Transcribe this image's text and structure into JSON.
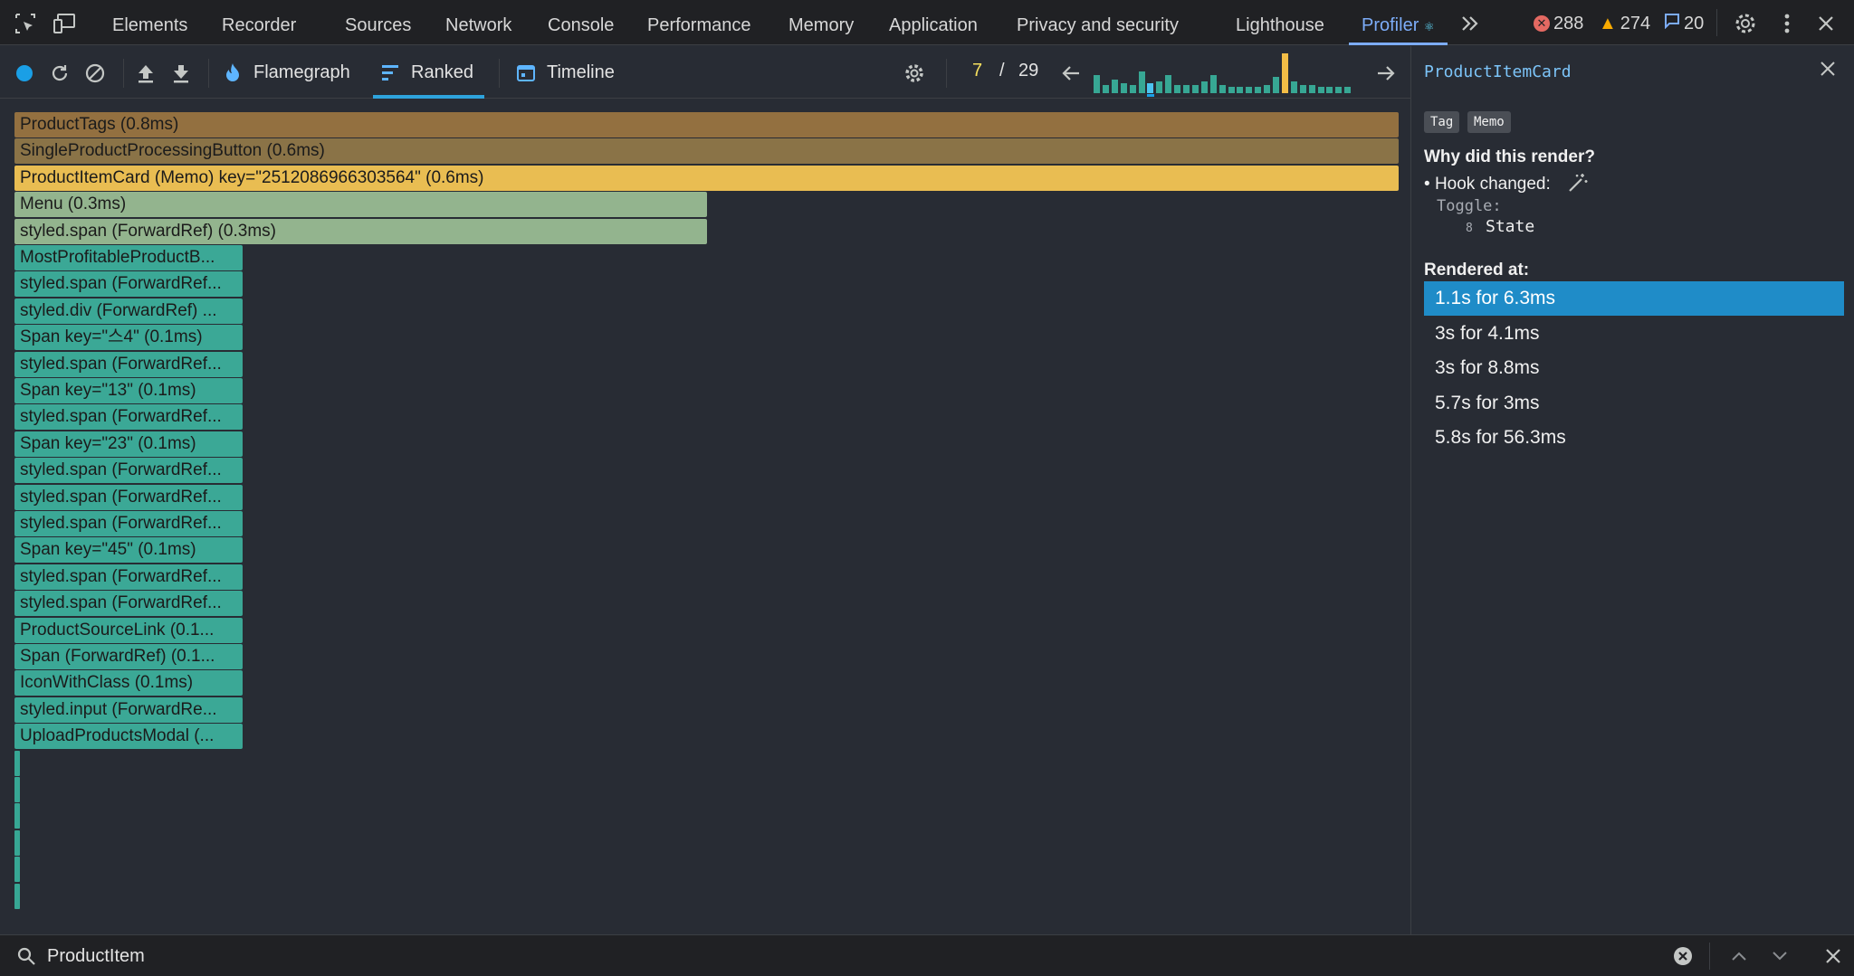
{
  "topbar": {
    "tabs": [
      {
        "label": "Elements"
      },
      {
        "label": "Recorder"
      },
      {
        "label": "Sources"
      },
      {
        "label": "Network"
      },
      {
        "label": "Console"
      },
      {
        "label": "Performance"
      },
      {
        "label": "Memory"
      },
      {
        "label": "Application"
      },
      {
        "label": "Privacy and security"
      },
      {
        "label": "Lighthouse"
      },
      {
        "label": "Profiler"
      }
    ],
    "active_tab": "Profiler",
    "errors": "288",
    "warnings": "274",
    "messages": "20",
    "icons": [
      "inspect-element-icon",
      "device-toggle-icon",
      "more-tabs-icon",
      "settings-gear-icon",
      "kebab-menu-icon",
      "close-icon"
    ]
  },
  "toolbar": {
    "modes": [
      {
        "label": "Flamegraph",
        "icon": "flame-icon"
      },
      {
        "label": "Ranked",
        "icon": "ranked-bars-icon"
      },
      {
        "label": "Timeline",
        "icon": "calendar-icon"
      }
    ],
    "active_mode": "Ranked",
    "commit_current": "7",
    "commit_sep": "/",
    "commit_total": "29",
    "commit_bars": [
      0.45,
      0.2,
      0.35,
      0.25,
      0.2,
      0.55,
      0.25,
      0.3,
      0.45,
      0.2,
      0.2,
      0.2,
      0.3,
      0.45,
      0.2,
      0.15,
      0.15,
      0.15,
      0.15,
      0.2,
      0.4,
      1.0,
      0.3,
      0.2,
      0.2,
      0.15,
      0.15,
      0.15,
      0.15
    ],
    "commit_selected_index": 6,
    "commit_highlight_index": 21
  },
  "ranked": {
    "rows": [
      {
        "label": "ProductTags (0.8ms)",
        "width": 1.0,
        "color": "#937040"
      },
      {
        "label": "SingleProductProcessingButton (0.6ms)",
        "width": 1.0,
        "color": "#8a7347"
      },
      {
        "label": "ProductItemCard (Memo) key=\"2512086966303564\" (0.6ms)",
        "width": 1.0,
        "color": "#e9bd52"
      },
      {
        "label": "Menu (0.3ms)",
        "width": 0.5,
        "color": "#93b48e"
      },
      {
        "label": "styled.span (ForwardRef) (0.3ms)",
        "width": 0.5,
        "color": "#93b48e"
      },
      {
        "label": "MostProfitableProductB...",
        "width": 0.165,
        "color": "#3ba896"
      },
      {
        "label": "styled.span (ForwardRef...",
        "width": 0.165,
        "color": "#3ba896"
      },
      {
        "label": "styled.div (ForwardRef) ...",
        "width": 0.165,
        "color": "#3ba896"
      },
      {
        "label": "Span key=\"스4\" (0.1ms)",
        "width": 0.165,
        "color": "#3ba896"
      },
      {
        "label": "styled.span (ForwardRef...",
        "width": 0.165,
        "color": "#3ba896"
      },
      {
        "label": "Span key=\"13\" (0.1ms)",
        "width": 0.165,
        "color": "#3ba896"
      },
      {
        "label": "styled.span (ForwardRef...",
        "width": 0.165,
        "color": "#3ba896"
      },
      {
        "label": "Span key=\"23\" (0.1ms)",
        "width": 0.165,
        "color": "#3ba896"
      },
      {
        "label": "styled.span (ForwardRef...",
        "width": 0.165,
        "color": "#3ba896"
      },
      {
        "label": "styled.span (ForwardRef...",
        "width": 0.165,
        "color": "#3ba896"
      },
      {
        "label": "styled.span (ForwardRef...",
        "width": 0.165,
        "color": "#3ba896"
      },
      {
        "label": "Span key=\"45\" (0.1ms)",
        "width": 0.165,
        "color": "#3ba896"
      },
      {
        "label": "styled.span (ForwardRef...",
        "width": 0.165,
        "color": "#3ba896"
      },
      {
        "label": "styled.span (ForwardRef...",
        "width": 0.165,
        "color": "#3ba896"
      },
      {
        "label": "ProductSourceLink (0.1...",
        "width": 0.165,
        "color": "#3ba896"
      },
      {
        "label": "Span (ForwardRef) (0.1...",
        "width": 0.165,
        "color": "#3ba896"
      },
      {
        "label": "IconWithClass (0.1ms)",
        "width": 0.165,
        "color": "#3ba896"
      },
      {
        "label": "styled.input (ForwardRe...",
        "width": 0.165,
        "color": "#3ba896"
      },
      {
        "label": "UploadProductsModal (...",
        "width": 0.165,
        "color": "#3ba896"
      }
    ],
    "sliver_count": 6
  },
  "sidepanel": {
    "title": "ProductItemCard",
    "chips": [
      "Tag",
      "Memo"
    ],
    "why_heading": "Why did this render?",
    "hook_changed": "Hook changed:",
    "hook_name": "Toggle:",
    "hook_index": "8",
    "hook_value": "State",
    "rendered_heading": "Rendered at:",
    "renders": [
      {
        "label": "1.1s for 6.3ms"
      },
      {
        "label": "3s for 4.1ms"
      },
      {
        "label": "3s for 8.8ms"
      },
      {
        "label": "5.7s for 3ms"
      },
      {
        "label": "5.8s for 56.3ms"
      }
    ],
    "selected_render": 0
  },
  "search": {
    "value": "ProductItem"
  },
  "colors": {
    "accent": "#7cacf8",
    "selected_blue": "#1f8cc8",
    "error": "#e46962",
    "warning": "#f9ab00"
  }
}
